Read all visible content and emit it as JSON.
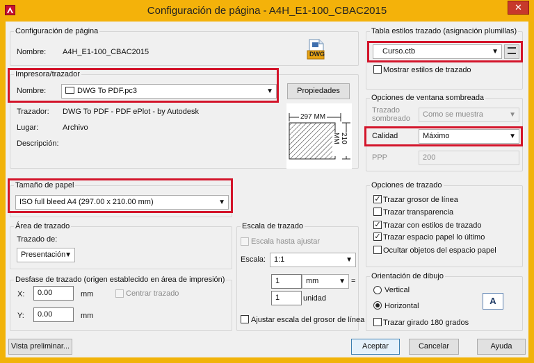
{
  "window": {
    "title": "Configuración de página - A4H_E1-100_CBAC2015",
    "close_glyph": "✕",
    "app_icon": "autocad-icon",
    "accent_color": "#f4b20a",
    "highlight_color": "#d3142a"
  },
  "page_setup": {
    "legend": "Configuración de página",
    "name_label": "Nombre:",
    "name_value": "A4H_E1-100_CBAC2015",
    "dwg_icon_text": "DWG"
  },
  "printer": {
    "legend": "Impresora/trazador",
    "name_label": "Nombre:",
    "name_value": "DWG To PDF.pc3",
    "properties_button": "Propiedades",
    "plotter_label": "Trazador:",
    "plotter_value": "DWG To PDF - PDF ePlot - by Autodesk",
    "where_label": "Lugar:",
    "where_value": "Archivo",
    "description_label": "Descripción:",
    "preview_width": "297 MM",
    "preview_height": "210 MM"
  },
  "paper_size": {
    "legend": "Tamaño de papel",
    "value": "ISO full bleed A4 (297.00 x 210.00 mm)"
  },
  "plot_area": {
    "legend": "Área de trazado",
    "what_label": "Trazado de:",
    "what_value": "Presentación"
  },
  "plot_offset": {
    "legend": "Desfase de trazado (origen establecido en área de impresión)",
    "x_label": "X:",
    "x_value": "0.00",
    "x_unit": "mm",
    "y_label": "Y:",
    "y_value": "0.00",
    "y_unit": "mm",
    "center_label": "Centrar trazado"
  },
  "plot_scale": {
    "legend": "Escala de trazado",
    "fit_label": "Escala hasta ajustar",
    "scale_label": "Escala:",
    "scale_value": "1:1",
    "mm_value": "1",
    "mm_unit": "mm",
    "equals": "=",
    "unit_value": "1",
    "unit_label": "unidad",
    "lineweights_label": "Ajustar escala del grosor de línea"
  },
  "plot_style_table": {
    "legend": "Tabla estilos trazado (asignación plumillas)",
    "value": "Curso.ctb",
    "display_label": "Mostrar estilos de trazado"
  },
  "shaded_viewport": {
    "legend": "Opciones de ventana sombreada",
    "shade_label_1": "Trazado",
    "shade_label_2": "sombreado",
    "shade_value": "Como se muestra",
    "quality_label": "Calidad",
    "quality_value": "Máximo",
    "dpi_label": "PPP",
    "dpi_value": "200"
  },
  "plot_options": {
    "legend": "Opciones de trazado",
    "items": [
      {
        "label": "Trazar grosor de línea",
        "checked": true
      },
      {
        "label": "Trazar transparencia",
        "checked": false
      },
      {
        "label": "Trazar con estilos de trazado",
        "checked": true
      },
      {
        "label": "Trazar espacio papel lo último",
        "checked": true
      },
      {
        "label": "Ocultar objetos del espacio papel",
        "checked": false
      }
    ]
  },
  "orientation": {
    "legend": "Orientación de dibujo",
    "portrait": "Vertical",
    "landscape": "Horizontal",
    "upside_down": "Trazar girado 180 grados",
    "icon_letter": "A"
  },
  "footer": {
    "preview_button": "Vista preliminar...",
    "ok_button": "Aceptar",
    "cancel_button": "Cancelar",
    "help_button": "Ayuda"
  }
}
